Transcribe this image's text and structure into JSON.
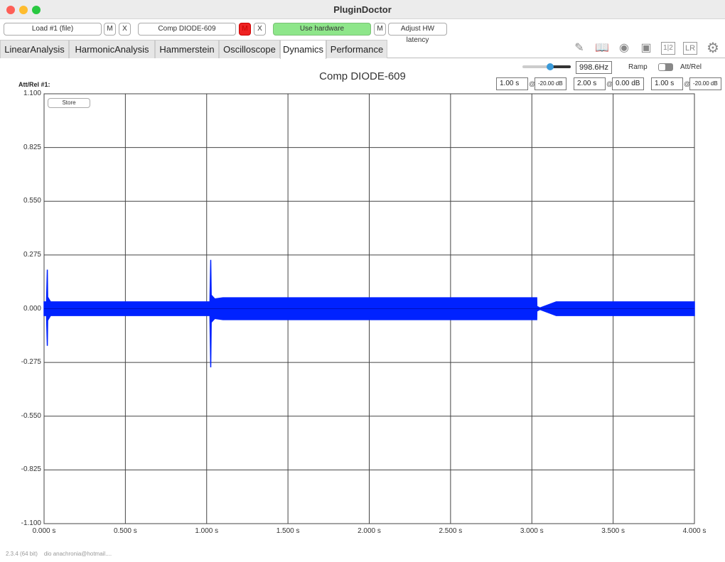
{
  "window": {
    "title": "PluginDoctor"
  },
  "toolbar": {
    "load": "Load #1 (file)",
    "m1": "M",
    "x1": "X",
    "plugin": "Comp DIODE-609",
    "m2": "M",
    "x2": "X",
    "hardware": "Use hardware",
    "m3": "M",
    "latency": "Adjust HW latency"
  },
  "tabs": [
    "LinearAnalysis",
    "HarmonicAnalysis",
    "Hammerstein",
    "Oscilloscope",
    "Dynamics",
    "Performance"
  ],
  "icons": [
    "notes-icon",
    "book-icon",
    "eye-icon",
    "camera-icon",
    "one-two-icon",
    "lr-icon",
    "gear-icon"
  ],
  "icon_text": {
    "onetwo": "1|2",
    "lr": "LR"
  },
  "controls": {
    "frequency": "998.6Hz",
    "frequency_slider": 0.6,
    "ramp": "Ramp",
    "attrel": "Att/Rel",
    "t1": "1.00 s",
    "l1": "-20.00 dB",
    "t2": "2.00 s",
    "l2": "0.00 dB",
    "t3": "1.00 s",
    "l3": "-20.00 dB",
    "at": "@"
  },
  "plot": {
    "label": "Att/Rel #1:",
    "store": "Store",
    "color": "#0022ff"
  },
  "footer": {
    "version": "2.3.4 (64 bit)",
    "user": "dio anachronia@hotmail...."
  },
  "chart_data": {
    "type": "line",
    "title": "Comp DIODE-609",
    "xlabel": "",
    "ylabel": "",
    "xlim": [
      0,
      4
    ],
    "ylim": [
      -1.1,
      1.1
    ],
    "grid": true,
    "xticks": [
      "0.000 s",
      "0.500 s",
      "1.000 s",
      "1.500 s",
      "2.000 s",
      "2.500 s",
      "3.000 s",
      "3.500 s",
      "4.000 s"
    ],
    "yticks": [
      "1.100",
      "0.825",
      "0.550",
      "0.275",
      "0.000",
      "-0.275",
      "-0.550",
      "-0.825",
      "-1.100"
    ],
    "envelope": [
      [
        0,
        0.035
      ],
      [
        0.015,
        0.035
      ],
      [
        0.02,
        0.2
      ],
      [
        0.022,
        0.06
      ],
      [
        0.04,
        0.035
      ],
      [
        1.02,
        0.035
      ],
      [
        1.025,
        0.25
      ],
      [
        1.028,
        0.07
      ],
      [
        1.05,
        0.05
      ],
      [
        1.1,
        0.056
      ],
      [
        3.03,
        0.056
      ],
      [
        3.031,
        0.012
      ],
      [
        3.05,
        0.004
      ],
      [
        3.15,
        0.035
      ],
      [
        4,
        0.035
      ]
    ],
    "envelope_low": [
      [
        0,
        -0.035
      ],
      [
        0.015,
        -0.035
      ],
      [
        0.02,
        -0.19
      ],
      [
        0.022,
        -0.06
      ],
      [
        0.04,
        -0.035
      ],
      [
        1.02,
        -0.035
      ],
      [
        1.025,
        -0.3
      ],
      [
        1.028,
        -0.07
      ],
      [
        1.05,
        -0.05
      ],
      [
        1.1,
        -0.056
      ],
      [
        3.03,
        -0.056
      ],
      [
        3.031,
        -0.012
      ],
      [
        3.05,
        -0.004
      ],
      [
        3.15,
        -0.035
      ],
      [
        4,
        -0.035
      ]
    ]
  }
}
